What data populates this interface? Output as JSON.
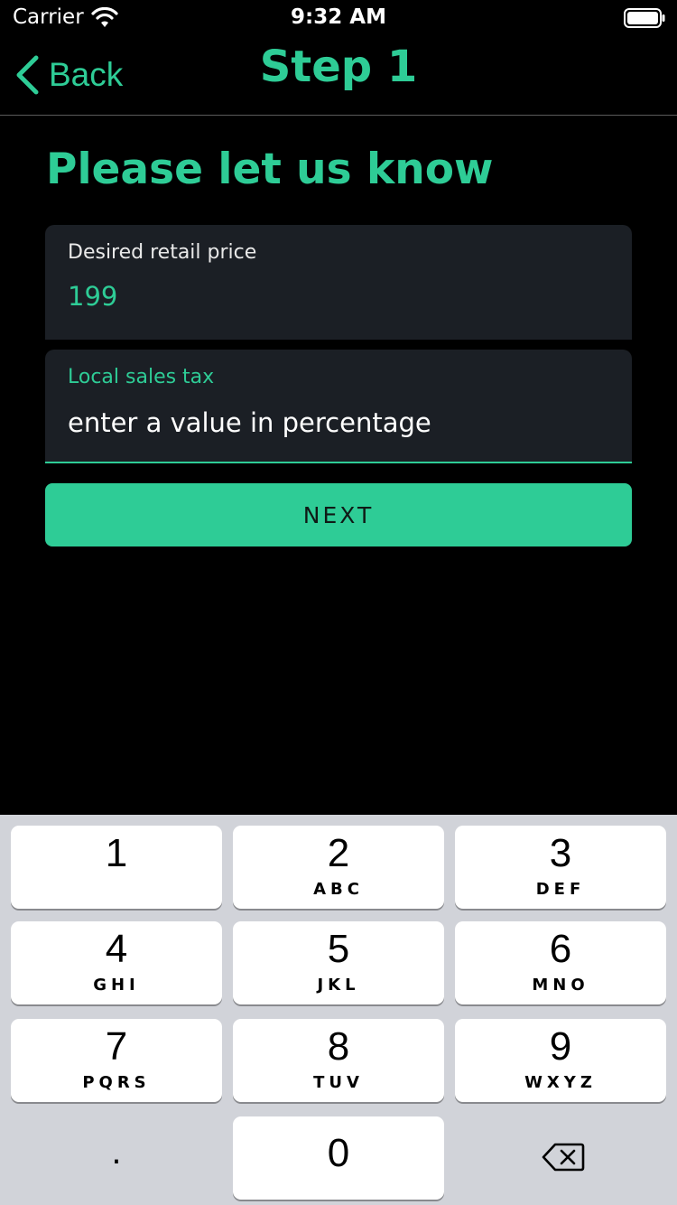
{
  "status_bar": {
    "carrier": "Carrier",
    "time": "9:32 AM"
  },
  "nav": {
    "back_label": "Back",
    "title": "Step 1"
  },
  "heading": "Please let us know",
  "form": {
    "price": {
      "label": "Desired retail price",
      "value": "199"
    },
    "tax": {
      "label": "Local sales tax",
      "placeholder": "enter a value in percentage"
    },
    "next_label": "NEXT"
  },
  "keyboard": {
    "keys": [
      {
        "digit": "1",
        "letters": ""
      },
      {
        "digit": "2",
        "letters": "ABC"
      },
      {
        "digit": "3",
        "letters": "DEF"
      },
      {
        "digit": "4",
        "letters": "GHI"
      },
      {
        "digit": "5",
        "letters": "JKL"
      },
      {
        "digit": "6",
        "letters": "MNO"
      },
      {
        "digit": "7",
        "letters": "PQRS"
      },
      {
        "digit": "8",
        "letters": "TUV"
      },
      {
        "digit": "9",
        "letters": "WXYZ"
      },
      {
        "digit": "0",
        "letters": ""
      }
    ],
    "decimal": "."
  },
  "colors": {
    "accent": "#2ecc96",
    "field_bg": "#1b1f25",
    "keyboard_bg": "#d1d3d9"
  },
  "icons": [
    "wifi-icon",
    "battery-icon",
    "back-chevron-icon",
    "delete-icon"
  ]
}
